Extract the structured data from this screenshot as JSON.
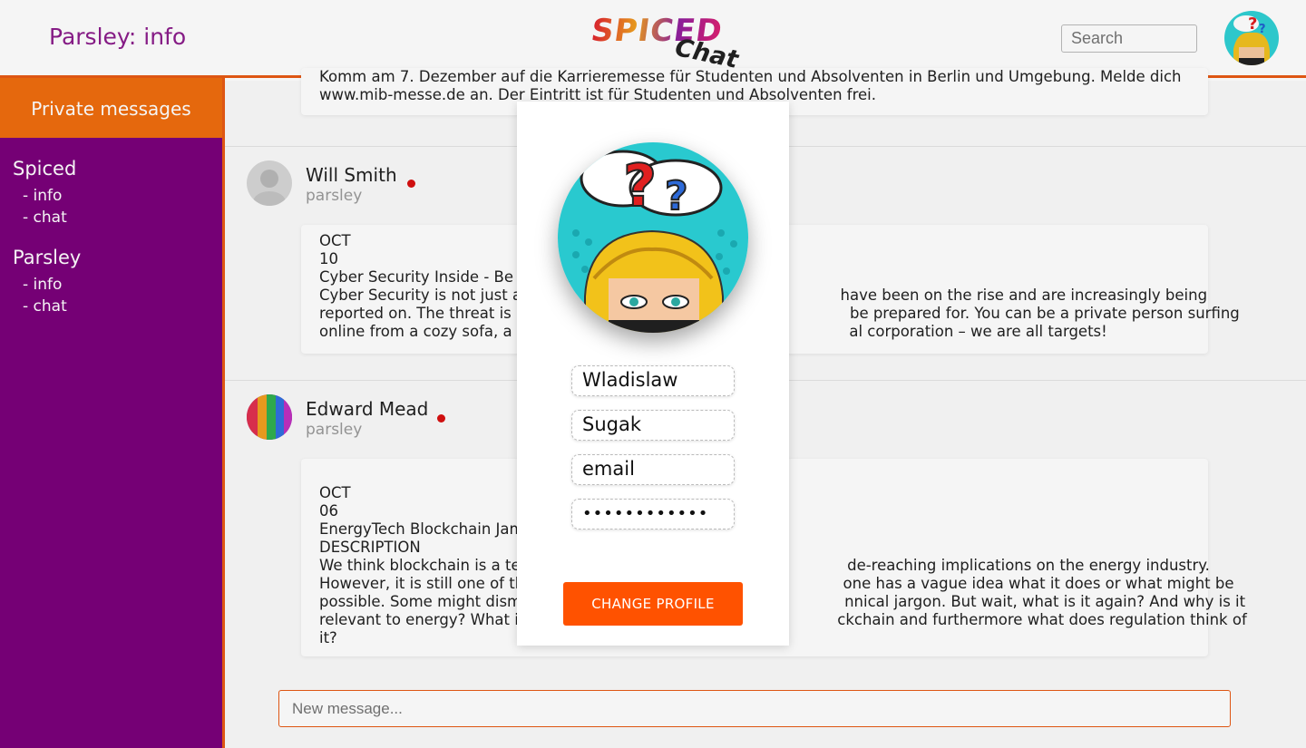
{
  "header": {
    "title": "Parsley: info",
    "logo_word1": "SPICED",
    "logo_word2": "Chat",
    "search_placeholder": "Search"
  },
  "sidebar": {
    "heading": "Private messages",
    "groups": [
      {
        "name": "Spiced",
        "links": [
          "- info",
          "- chat"
        ]
      },
      {
        "name": "Parsley",
        "links": [
          "- info",
          "- chat"
        ]
      }
    ]
  },
  "messages": {
    "top_card_lines": [
      "Komm am 7. Dezember auf die Karrieremesse für Studenten und Absolventen in Berlin und Umgebung. Melde dich auf",
      "www.mib-messe.de an. Der Eintritt ist für Studenten und Absolventen frei."
    ],
    "items": [
      {
        "author": "Will Smith",
        "handle": "parsley",
        "lines": [
          "OCT",
          "10",
          "Cyber Security Inside - Be P",
          "Cyber Security is not just a                                                                   have been on the rise and are increasingly being",
          "reported on. The threat is re                                                                   be prepared for. You can be a private person surfing",
          "online from a cozy sofa, a st                                                                   al corporation – we are all targets!"
        ]
      },
      {
        "author": "Edward Mead",
        "handle": "parsley",
        "lines": [
          "OCT",
          "06",
          "EnergyTech Blockchain Jam",
          "DESCRIPTION",
          "We think blockchain is a tec                                                                   de-reaching implications on the energy industry.",
          "However, it is still one of th                                                                   one has a vague idea what it does or what might be",
          "possible. Some might dismi                                                                   nnical jargon. But wait, what is it again? And why is it",
          "relevant to energy? What i                                                                   ckchain and furthermore what does regulation think of",
          "it?"
        ]
      }
    ],
    "new_message_placeholder": "New message..."
  },
  "modal": {
    "first_name": "Wladislaw",
    "last_name": "Sugak",
    "email": "email",
    "password": "••••••••••••",
    "button_label": "CHANGE PROFILE"
  },
  "colors": {
    "accent": "#ff5200",
    "sidebar": "#7a007a",
    "title": "#8b1d8b",
    "online_dot": "#d81010"
  }
}
